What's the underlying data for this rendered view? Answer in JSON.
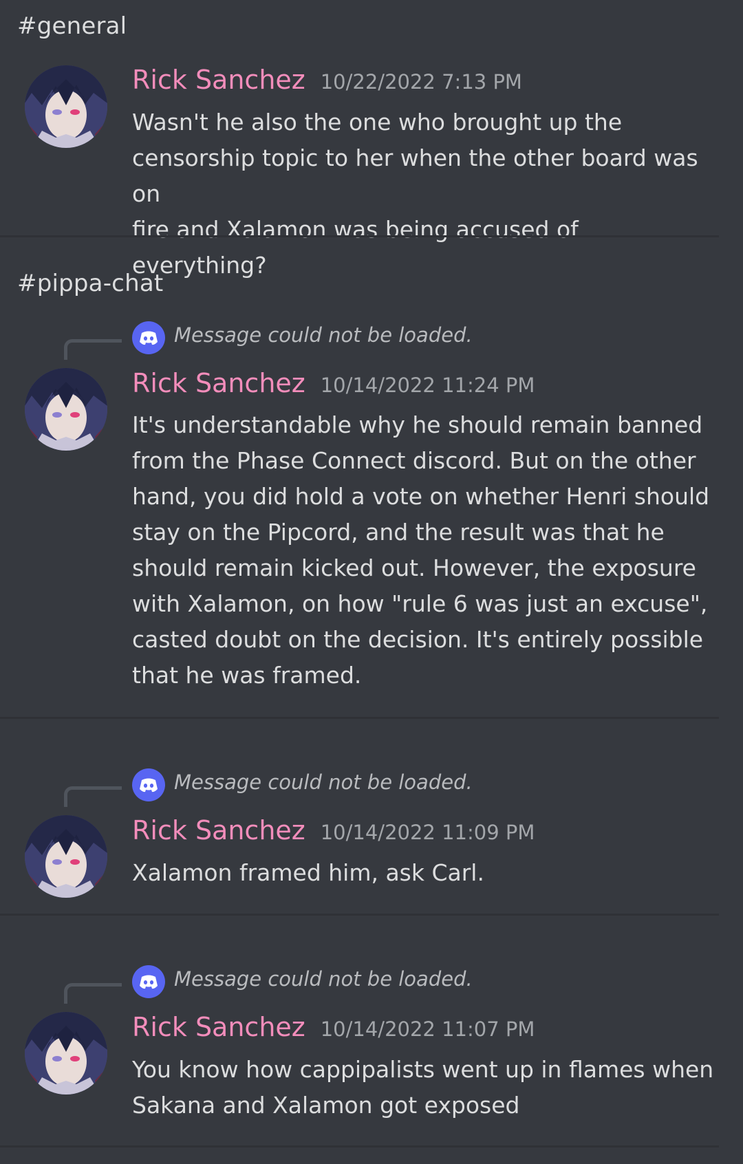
{
  "sections": [
    {
      "channel": "#general",
      "messages": [
        {
          "author": "Rick Sanchez",
          "timestamp": "10/22/2022 7:13 PM",
          "reply": null,
          "lines": [
            "Wasn't he also the one who brought up the",
            "censorship topic to her when the other board was on",
            "fire and Xalamon was being accused of everything?"
          ]
        }
      ]
    },
    {
      "channel": "#pippa-chat",
      "messages": [
        {
          "author": "Rick Sanchez",
          "timestamp": "10/14/2022 11:24 PM",
          "reply": "Message could not be loaded.",
          "lines": [
            "It's understandable why he should remain banned",
            "from the Phase Connect discord. But on the other",
            "hand, you did hold a vote on whether Henri should",
            "stay on the Pipcord, and the result was that he",
            "should remain kicked out. However, the exposure",
            "with Xalamon, on how \"rule 6 was just an excuse\",",
            "casted doubt on the decision. It's entirely possible",
            "that he was framed."
          ]
        },
        {
          "author": "Rick Sanchez",
          "timestamp": "10/14/2022 11:09 PM",
          "reply": "Message could not be loaded.",
          "lines": [
            "Xalamon framed him, ask Carl."
          ]
        },
        {
          "author": "Rick Sanchez",
          "timestamp": "10/14/2022 11:07 PM",
          "reply": "Message could not be loaded.",
          "lines": [
            "You know how cappipalists went up in flames when",
            "Sakana and Xalamon got exposed"
          ]
        }
      ]
    }
  ],
  "icons": {
    "avatar": "user-avatar-anime-character",
    "reply": "discord-logo-icon"
  },
  "colors": {
    "background": "#36393f",
    "divider": "#2f3136",
    "author": "#f38dbb",
    "timestamp": "#a3a6aa",
    "text": "#dcddde",
    "reply_icon": "#5865f2"
  }
}
